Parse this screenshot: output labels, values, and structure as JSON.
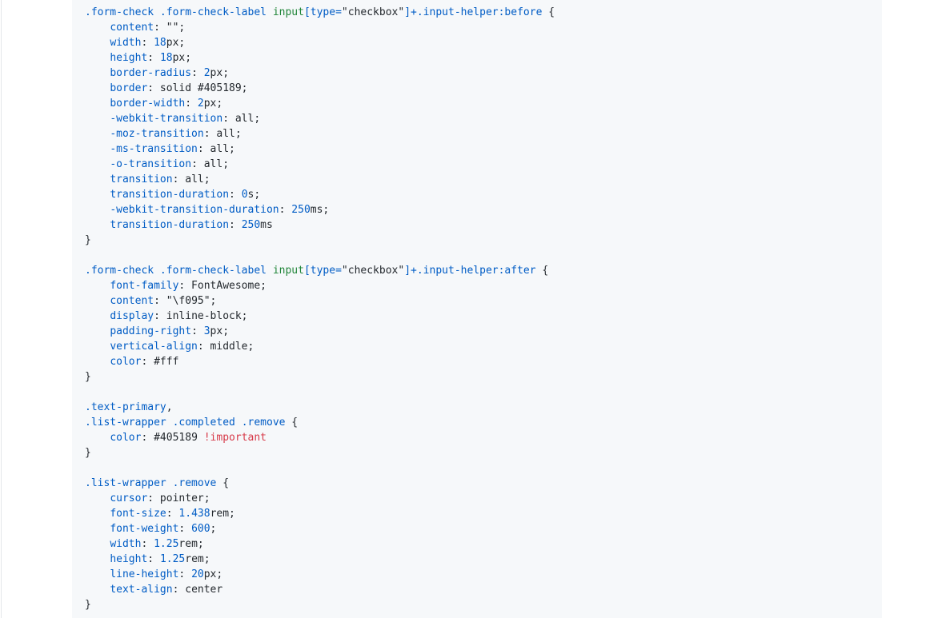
{
  "code_view": {
    "language": "css",
    "lines": [
      [
        {
          "t": "sel",
          "v": ".form-check"
        },
        {
          "t": "punc",
          "v": " "
        },
        {
          "t": "sel",
          "v": ".form-check-label"
        },
        {
          "t": "punc",
          "v": " "
        },
        {
          "t": "tag",
          "v": "input"
        },
        {
          "t": "sel",
          "v": "[type="
        },
        {
          "t": "str",
          "v": "\"checkbox\""
        },
        {
          "t": "sel",
          "v": "]+.input-helper:before"
        },
        {
          "t": "punc",
          "v": " {"
        }
      ],
      [
        {
          "t": "punc",
          "v": "    "
        },
        {
          "t": "prop",
          "v": "content"
        },
        {
          "t": "punc",
          "v": ": \"\";"
        }
      ],
      [
        {
          "t": "punc",
          "v": "    "
        },
        {
          "t": "prop",
          "v": "width"
        },
        {
          "t": "punc",
          "v": ": "
        },
        {
          "t": "num",
          "v": "18"
        },
        {
          "t": "punc",
          "v": "px;"
        }
      ],
      [
        {
          "t": "punc",
          "v": "    "
        },
        {
          "t": "prop",
          "v": "height"
        },
        {
          "t": "punc",
          "v": ": "
        },
        {
          "t": "num",
          "v": "18"
        },
        {
          "t": "punc",
          "v": "px;"
        }
      ],
      [
        {
          "t": "punc",
          "v": "    "
        },
        {
          "t": "prop",
          "v": "border-radius"
        },
        {
          "t": "punc",
          "v": ": "
        },
        {
          "t": "num",
          "v": "2"
        },
        {
          "t": "punc",
          "v": "px;"
        }
      ],
      [
        {
          "t": "punc",
          "v": "    "
        },
        {
          "t": "prop",
          "v": "border"
        },
        {
          "t": "punc",
          "v": ": solid #405189;"
        }
      ],
      [
        {
          "t": "punc",
          "v": "    "
        },
        {
          "t": "prop",
          "v": "border-width"
        },
        {
          "t": "punc",
          "v": ": "
        },
        {
          "t": "num",
          "v": "2"
        },
        {
          "t": "punc",
          "v": "px;"
        }
      ],
      [
        {
          "t": "punc",
          "v": "    "
        },
        {
          "t": "prop",
          "v": "-webkit-transition"
        },
        {
          "t": "punc",
          "v": ": all;"
        }
      ],
      [
        {
          "t": "punc",
          "v": "    "
        },
        {
          "t": "prop",
          "v": "-moz-transition"
        },
        {
          "t": "punc",
          "v": ": all;"
        }
      ],
      [
        {
          "t": "punc",
          "v": "    "
        },
        {
          "t": "prop",
          "v": "-ms-transition"
        },
        {
          "t": "punc",
          "v": ": all;"
        }
      ],
      [
        {
          "t": "punc",
          "v": "    "
        },
        {
          "t": "prop",
          "v": "-o-transition"
        },
        {
          "t": "punc",
          "v": ": all;"
        }
      ],
      [
        {
          "t": "punc",
          "v": "    "
        },
        {
          "t": "prop",
          "v": "transition"
        },
        {
          "t": "punc",
          "v": ": all;"
        }
      ],
      [
        {
          "t": "punc",
          "v": "    "
        },
        {
          "t": "prop",
          "v": "transition-duration"
        },
        {
          "t": "punc",
          "v": ": "
        },
        {
          "t": "num",
          "v": "0"
        },
        {
          "t": "punc",
          "v": "s;"
        }
      ],
      [
        {
          "t": "punc",
          "v": "    "
        },
        {
          "t": "prop",
          "v": "-webkit-transition-duration"
        },
        {
          "t": "punc",
          "v": ": "
        },
        {
          "t": "num",
          "v": "250"
        },
        {
          "t": "punc",
          "v": "ms;"
        }
      ],
      [
        {
          "t": "punc",
          "v": "    "
        },
        {
          "t": "prop",
          "v": "transition-duration"
        },
        {
          "t": "punc",
          "v": ": "
        },
        {
          "t": "num",
          "v": "250"
        },
        {
          "t": "punc",
          "v": "ms"
        }
      ],
      [
        {
          "t": "punc",
          "v": "}"
        }
      ],
      [],
      [
        {
          "t": "sel",
          "v": ".form-check"
        },
        {
          "t": "punc",
          "v": " "
        },
        {
          "t": "sel",
          "v": ".form-check-label"
        },
        {
          "t": "punc",
          "v": " "
        },
        {
          "t": "tag",
          "v": "input"
        },
        {
          "t": "sel",
          "v": "[type="
        },
        {
          "t": "str",
          "v": "\"checkbox\""
        },
        {
          "t": "sel",
          "v": "]+.input-helper:after"
        },
        {
          "t": "punc",
          "v": " {"
        }
      ],
      [
        {
          "t": "punc",
          "v": "    "
        },
        {
          "t": "prop",
          "v": "font-family"
        },
        {
          "t": "punc",
          "v": ": FontAwesome;"
        }
      ],
      [
        {
          "t": "punc",
          "v": "    "
        },
        {
          "t": "prop",
          "v": "content"
        },
        {
          "t": "punc",
          "v": ": \"\\f095\";"
        }
      ],
      [
        {
          "t": "punc",
          "v": "    "
        },
        {
          "t": "prop",
          "v": "display"
        },
        {
          "t": "punc",
          "v": ": inline-block;"
        }
      ],
      [
        {
          "t": "punc",
          "v": "    "
        },
        {
          "t": "prop",
          "v": "padding-right"
        },
        {
          "t": "punc",
          "v": ": "
        },
        {
          "t": "num",
          "v": "3"
        },
        {
          "t": "punc",
          "v": "px;"
        }
      ],
      [
        {
          "t": "punc",
          "v": "    "
        },
        {
          "t": "prop",
          "v": "vertical-align"
        },
        {
          "t": "punc",
          "v": ": middle;"
        }
      ],
      [
        {
          "t": "punc",
          "v": "    "
        },
        {
          "t": "prop",
          "v": "color"
        },
        {
          "t": "punc",
          "v": ": #fff"
        }
      ],
      [
        {
          "t": "punc",
          "v": "}"
        }
      ],
      [],
      [
        {
          "t": "sel",
          "v": ".text-primary"
        },
        {
          "t": "punc",
          "v": ","
        }
      ],
      [
        {
          "t": "sel",
          "v": ".list-wrapper"
        },
        {
          "t": "punc",
          "v": " "
        },
        {
          "t": "sel",
          "v": ".completed"
        },
        {
          "t": "punc",
          "v": " "
        },
        {
          "t": "sel",
          "v": ".remove"
        },
        {
          "t": "punc",
          "v": " {"
        }
      ],
      [
        {
          "t": "punc",
          "v": "    "
        },
        {
          "t": "prop",
          "v": "color"
        },
        {
          "t": "punc",
          "v": ": #405189 "
        },
        {
          "t": "imp",
          "v": "!important"
        }
      ],
      [
        {
          "t": "punc",
          "v": "}"
        }
      ],
      [],
      [
        {
          "t": "sel",
          "v": ".list-wrapper"
        },
        {
          "t": "punc",
          "v": " "
        },
        {
          "t": "sel",
          "v": ".remove"
        },
        {
          "t": "punc",
          "v": " {"
        }
      ],
      [
        {
          "t": "punc",
          "v": "    "
        },
        {
          "t": "prop",
          "v": "cursor"
        },
        {
          "t": "punc",
          "v": ": pointer;"
        }
      ],
      [
        {
          "t": "punc",
          "v": "    "
        },
        {
          "t": "prop",
          "v": "font-size"
        },
        {
          "t": "punc",
          "v": ": "
        },
        {
          "t": "num",
          "v": "1.438"
        },
        {
          "t": "punc",
          "v": "rem;"
        }
      ],
      [
        {
          "t": "punc",
          "v": "    "
        },
        {
          "t": "prop",
          "v": "font-weight"
        },
        {
          "t": "punc",
          "v": ": "
        },
        {
          "t": "num",
          "v": "600"
        },
        {
          "t": "punc",
          "v": ";"
        }
      ],
      [
        {
          "t": "punc",
          "v": "    "
        },
        {
          "t": "prop",
          "v": "width"
        },
        {
          "t": "punc",
          "v": ": "
        },
        {
          "t": "num",
          "v": "1.25"
        },
        {
          "t": "punc",
          "v": "rem;"
        }
      ],
      [
        {
          "t": "punc",
          "v": "    "
        },
        {
          "t": "prop",
          "v": "height"
        },
        {
          "t": "punc",
          "v": ": "
        },
        {
          "t": "num",
          "v": "1.25"
        },
        {
          "t": "punc",
          "v": "rem;"
        }
      ],
      [
        {
          "t": "punc",
          "v": "    "
        },
        {
          "t": "prop",
          "v": "line-height"
        },
        {
          "t": "punc",
          "v": ": "
        },
        {
          "t": "num",
          "v": "20"
        },
        {
          "t": "punc",
          "v": "px;"
        }
      ],
      [
        {
          "t": "punc",
          "v": "    "
        },
        {
          "t": "prop",
          "v": "text-align"
        },
        {
          "t": "punc",
          "v": ": center"
        }
      ],
      [
        {
          "t": "punc",
          "v": "}"
        }
      ]
    ]
  }
}
